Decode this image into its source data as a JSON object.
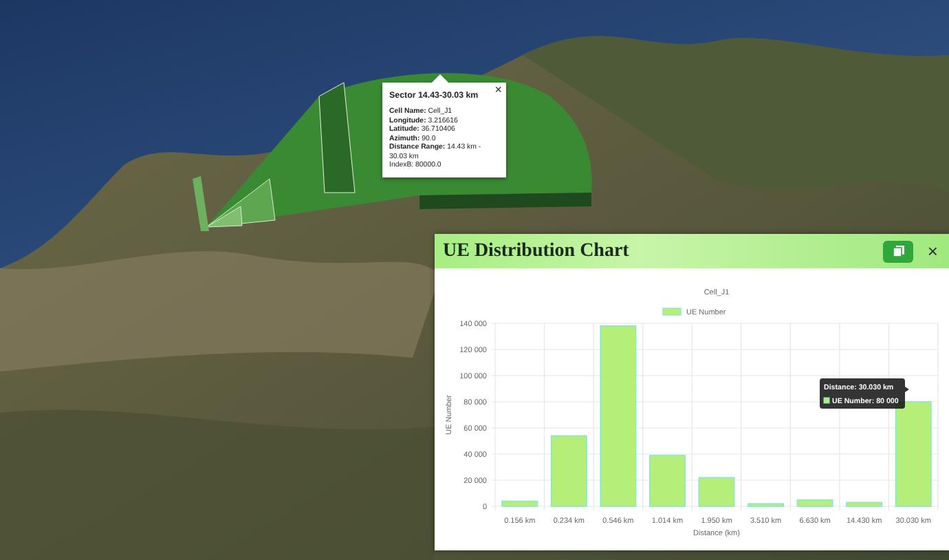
{
  "map_popup": {
    "title": "Sector 14.43-30.03 km",
    "close": "×",
    "lines": [
      "**Cell Name:** Cell_J1",
      "**Longitude:** 3.216616",
      "**Latitude:** 36.710406",
      "**Azimuth:** 90.0",
      "**Distance Range:** 14.43 km - 30.03 km",
      "IndexB: 80000.0"
    ]
  },
  "chart_panel": {
    "title": "UE Distribution Chart",
    "close": "×",
    "chart_data": {
      "type": "bar",
      "title": "Cell_J1",
      "xlabel": "Distance (km)",
      "ylabel": "UE Number",
      "categories": [
        "0.156 km",
        "0.234 km",
        "0.546 km",
        "1.014 km",
        "1.950 km",
        "3.510 km",
        "6.630 km",
        "14.430 km",
        "30.030 km"
      ],
      "series": [
        {
          "name": "UE Number",
          "color": "#b5ef7a",
          "values": [
            4000,
            54000,
            138000,
            39000,
            22000,
            2000,
            5000,
            3000,
            80000
          ]
        }
      ],
      "grid": true,
      "ylim": [
        0,
        140000
      ],
      "yticks": [
        {
          "value": 0,
          "label": "0"
        },
        {
          "value": 20000,
          "label": "20 000"
        },
        {
          "value": 40000,
          "label": "40 000"
        },
        {
          "value": 60000,
          "label": "60 000"
        },
        {
          "value": 80000,
          "label": "80 000"
        },
        {
          "value": 100000,
          "label": "100 000"
        },
        {
          "value": 120000,
          "label": "120 000"
        },
        {
          "value": 140000,
          "label": "140 000"
        }
      ]
    },
    "tooltip": {
      "title": "Distance: 30.030 km",
      "label": "UE Number: 80 000"
    }
  }
}
